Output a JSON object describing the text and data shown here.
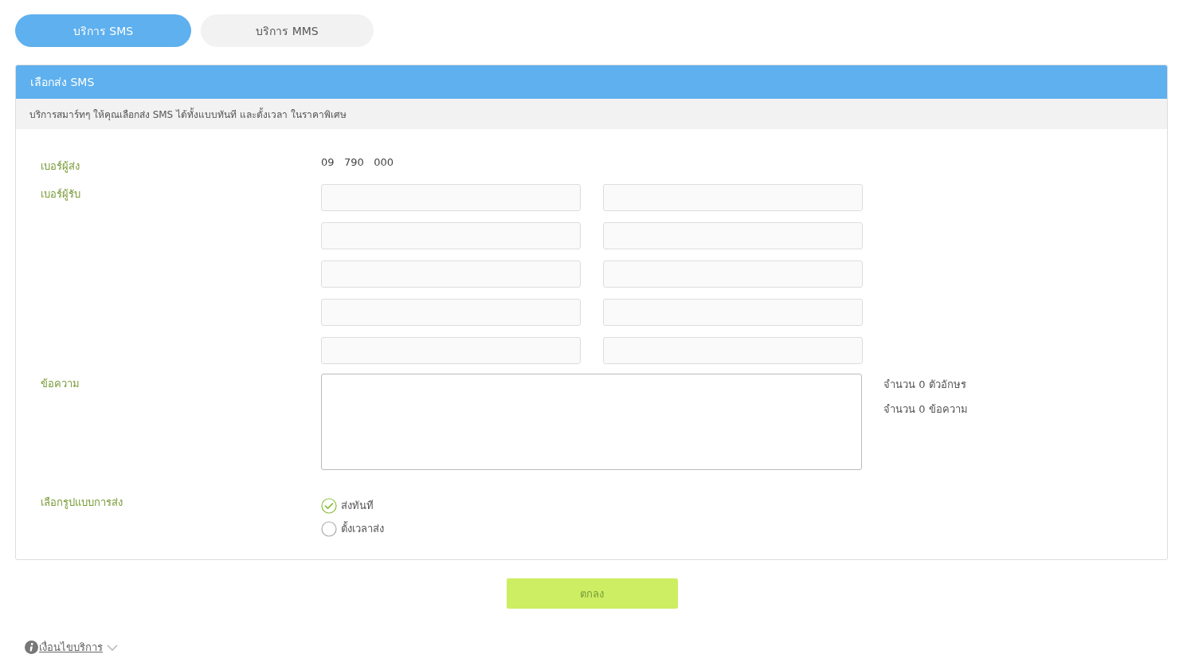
{
  "tabs": [
    {
      "label": "บริการ SMS",
      "selected": true
    },
    {
      "label": "บริการ MMS",
      "selected": false
    }
  ],
  "panel": {
    "title": "เลือกส่ง SMS",
    "description": "บริการสมาร์ทๆ ให้คุณเลือกส่ง SMS ได้ทั้งแบบทันที และตั้งเวลา ในราคาพิเศษ"
  },
  "sender": {
    "label": "เบอร์ผู้ส่ง",
    "value": "09   790   000"
  },
  "recipients": {
    "label": "เบอร์ผู้รับ",
    "fields": [
      {
        "kind": "input"
      },
      {
        "kind": "input"
      },
      {
        "kind": "input"
      },
      {
        "kind": "input"
      },
      {
        "kind": "input"
      },
      {
        "kind": "input"
      },
      {
        "kind": "input"
      },
      {
        "kind": "input"
      },
      {
        "kind": "input"
      },
      {
        "kind": "input"
      }
    ]
  },
  "message": {
    "label": "ข้อความ",
    "counters": [
      "จำนวน 0 ตัวอักษร",
      "จำนวน 0 ข้อความ"
    ]
  },
  "send_mode": {
    "label": "เลือกรูปแบบการส่ง",
    "options": [
      {
        "label": "ส่งทันที",
        "selected": true
      },
      {
        "label": "ตั้งเวลาส่ง",
        "selected": false
      }
    ]
  },
  "submit": {
    "label": "ตกลง"
  },
  "footer_link": {
    "label": "เงื่อนไขบริการ",
    "expanded": false
  }
}
